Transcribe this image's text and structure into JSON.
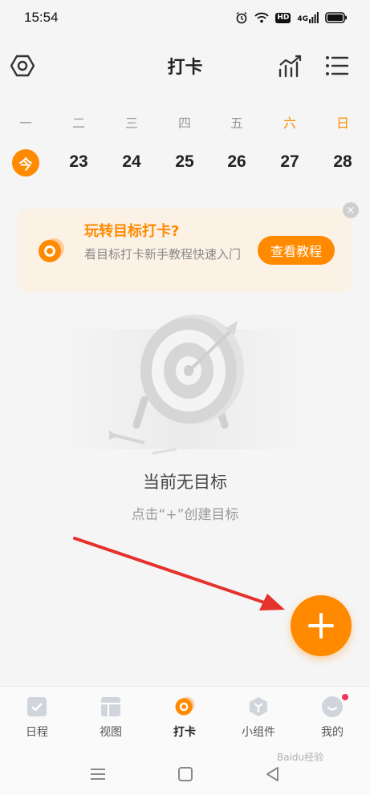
{
  "status": {
    "time": "15:54",
    "hd": "HD",
    "network": "4G"
  },
  "header": {
    "title": "打卡"
  },
  "week": {
    "days": [
      "一",
      "二",
      "三",
      "四",
      "五",
      "六",
      "日"
    ],
    "today_label": "今",
    "dates": [
      "23",
      "24",
      "25",
      "26",
      "27",
      "28"
    ]
  },
  "banner": {
    "title": "玩转目标打卡?",
    "description": "看目标打卡新手教程快速入门",
    "button_label": "查看教程",
    "close_glyph": "×"
  },
  "empty_state": {
    "title": "当前无目标",
    "hint": "点击“+”创建目标"
  },
  "fab": {
    "icon": "plus-icon"
  },
  "tabs": [
    {
      "label": "日程",
      "icon": "schedule-icon"
    },
    {
      "label": "视图",
      "icon": "view-icon"
    },
    {
      "label": "打卡",
      "icon": "checkin-icon",
      "active": true
    },
    {
      "label": "小组件",
      "icon": "widget-icon"
    },
    {
      "label": "我的",
      "icon": "profile-icon"
    }
  ],
  "colors": {
    "accent": "#ff8a00",
    "banner_bg": "#fbf1e4",
    "background": "#f5f5f5"
  },
  "watermark": "Baidu经验"
}
